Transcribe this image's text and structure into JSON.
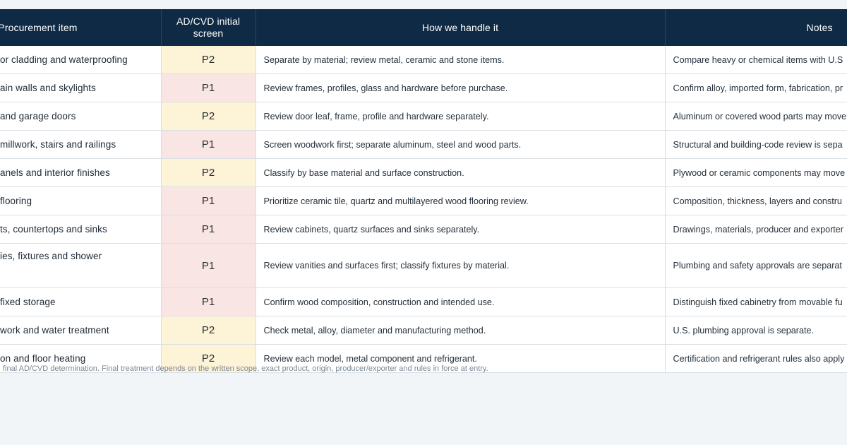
{
  "table": {
    "headers": {
      "item": "Procurement item",
      "screen": "AD/CVD initial screen",
      "handle": "How we handle it",
      "notes": "Notes"
    },
    "rows": [
      {
        "item": "or cladding and waterproofing",
        "screen": "P2",
        "handle": "Separate by material; review metal, ceramic and stone items.",
        "notes": "Compare heavy or chemical items with U.S"
      },
      {
        "item": "ain walls and skylights",
        "screen": "P1",
        "handle": "Review frames, profiles, glass and hardware before purchase.",
        "notes": "Confirm alloy, imported form, fabrication, pr"
      },
      {
        "item": "and garage doors",
        "screen": "P2",
        "handle": "Review door leaf, frame, profile and hardware separately.",
        "notes": "Aluminum or covered wood parts may move"
      },
      {
        "item": "millwork, stairs and railings",
        "screen": "P1",
        "handle": "Screen woodwork first; separate aluminum, steel and wood parts.",
        "notes": "Structural and building-code review is sepa"
      },
      {
        "item": "anels and interior finishes",
        "screen": "P2",
        "handle": "Classify by base material and surface construction.",
        "notes": "Plywood or ceramic components may move"
      },
      {
        "item": "flooring",
        "screen": "P1",
        "handle": "Prioritize ceramic tile, quartz and multilayered wood flooring review.",
        "notes": "Composition, thickness, layers and constru"
      },
      {
        "item": "ts, countertops and sinks",
        "screen": "P1",
        "handle": "Review cabinets, quartz surfaces and sinks separately.",
        "notes": "Drawings, materials, producer and exporter"
      },
      {
        "item": "ies, fixtures and shower",
        "screen": "P1",
        "handle": "Review vanities and surfaces first; classify fixtures by material.",
        "notes": "Plumbing and safety approvals are separat"
      },
      {
        "item": "fixed storage",
        "screen": "P1",
        "handle": "Confirm wood composition, construction and intended use.",
        "notes": "Distinguish fixed cabinetry from movable fu"
      },
      {
        "item": "work and water treatment",
        "screen": "P2",
        "handle": "Check metal, alloy, diameter and manufacturing method.",
        "notes": "U.S. plumbing approval is separate."
      },
      {
        "item": "on and floor heating",
        "screen": "P2",
        "handle": "Review each model, metal component and refrigerant.",
        "notes": "Certification and refrigerant rules also apply"
      }
    ]
  },
  "footnote": "final AD/CVD determination. Final treatment depends on the written scope, exact product, origin, producer/exporter and rules in force at entry.",
  "colors": {
    "header_bg": "#0f2a44",
    "p1_bg": "#f9e6e4",
    "p2_bg": "#fdf3d6",
    "page_bg": "#f2f5f7"
  }
}
